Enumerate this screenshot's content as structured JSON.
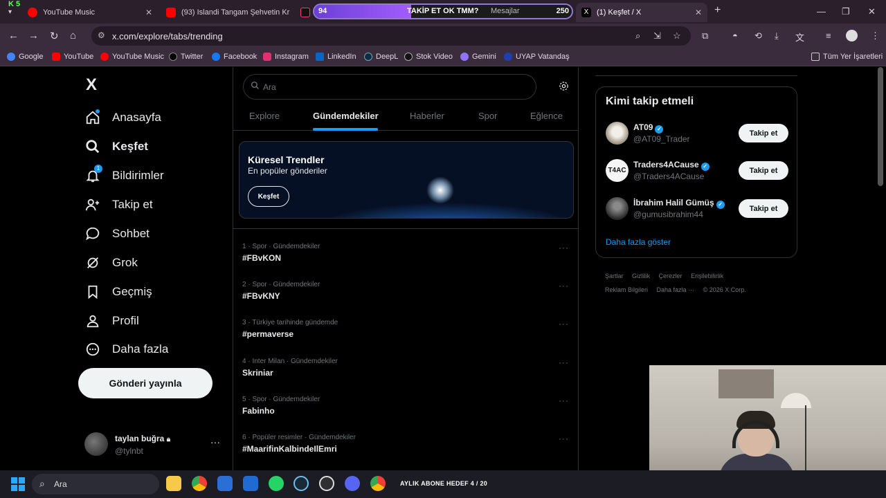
{
  "browser": {
    "tabs": [
      {
        "label": "YouTube Music",
        "color": "#ff0000"
      },
      {
        "label": "(93) Islandi Tangam Şehvetin Kr",
        "color": "#ff0000"
      },
      {
        "label": "Mesajlar",
        "color": "#111111"
      },
      {
        "label": "(1) Keşfet / X",
        "color": "#000000"
      }
    ],
    "overlay": {
      "left": "94",
      "center": "TAKİP ET OK TMM?",
      "right": "250",
      "progress": 0.376
    },
    "badge": "K 5",
    "url": "x.com/explore/tabs/trending",
    "bookmarks": [
      {
        "label": "Google",
        "color": "#4285f4"
      },
      {
        "label": "YouTube",
        "color": "#ff0000"
      },
      {
        "label": "YouTube Music",
        "color": "#ff0000"
      },
      {
        "label": "Twitter",
        "color": "#000000"
      },
      {
        "label": "Facebook",
        "color": "#1877f2"
      },
      {
        "label": "Instagram",
        "color": "#e1306c"
      },
      {
        "label": "LinkedIn",
        "color": "#0a66c2"
      },
      {
        "label": "DeepL",
        "color": "#0f2b46"
      },
      {
        "label": "Stok Video",
        "color": "#111111"
      },
      {
        "label": "Gemini",
        "color": "#8e75ff"
      },
      {
        "label": "UYAP Vatandaş",
        "color": "#1e40af"
      }
    ],
    "bookmarks_all": "Tüm Yer İşaretleri"
  },
  "nav": {
    "logo": "X",
    "items": [
      {
        "label": "Anasayfa",
        "icon": "home-icon"
      },
      {
        "label": "Keşfet",
        "icon": "search-icon"
      },
      {
        "label": "Bildirimler",
        "icon": "bell-icon",
        "badge": "1"
      },
      {
        "label": "Takip et",
        "icon": "person-add-icon"
      },
      {
        "label": "Sohbet",
        "icon": "chat-icon"
      },
      {
        "label": "Grok",
        "icon": "grok-icon"
      },
      {
        "label": "Geçmiş",
        "icon": "bookmark-icon"
      },
      {
        "label": "Profil",
        "icon": "person-icon"
      },
      {
        "label": "Daha fazla",
        "icon": "more-circle-icon"
      }
    ],
    "post_button": "Gönderi yayınla",
    "profile": {
      "name": "taylan buğra",
      "handle": "@tylnbt"
    }
  },
  "explore": {
    "search_placeholder": "Ara",
    "tabs": [
      "Explore",
      "Gündemdekiler",
      "Haberler",
      "Spor",
      "Eğlence"
    ],
    "active_tab": "Gündemdekiler",
    "banner": {
      "title": "Küresel Trendler",
      "subtitle": "En popüler gönderiler",
      "button": "Keşfet"
    },
    "trends": [
      {
        "meta": "1 · Spor · Gündemdekiler",
        "name": "#FBvKON"
      },
      {
        "meta": "2 · Spor · Gündemdekiler",
        "name": "#FBvKNY"
      },
      {
        "meta": "3 · Türkiye tarihinde gündemde",
        "name": "#permaverse"
      },
      {
        "meta": "4 · Inter Milan · Gündemdekiler",
        "name": "Skriniar"
      },
      {
        "meta": "5 · Spor · Gündemdekiler",
        "name": "Fabinho"
      },
      {
        "meta": "6 · Popüler resimler · Gündemdekiler",
        "name": "#MaarifinKalbindeIlEmri"
      }
    ]
  },
  "who_to_follow": {
    "title": "Kimi takip etmeli",
    "accounts": [
      {
        "name": "AT09",
        "handle": "@AT09_Trader",
        "button": "Takip et"
      },
      {
        "name": "Traders4ACause",
        "handle": "@Traders4ACause",
        "button": "Takip et"
      },
      {
        "name": "İbrahim Halil Gümüş",
        "handle": "@gumusibrahim44",
        "button": "Takip et"
      }
    ],
    "show_more": "Daha fazla göster"
  },
  "footer": [
    "Şartlar",
    "Gizlilik",
    "Çerezler",
    "Erişilebilirlik",
    "Reklam Bilgileri",
    "Daha fazla ···",
    "© 2026 X Corp."
  ],
  "taskbar": {
    "search_placeholder": "Ara",
    "goal": "AYLIK ABONE HEDEF 4 / 20"
  },
  "colors": {
    "accent": "#1d9bf0",
    "background": "#000000",
    "browser_frame": "#3a2c3c"
  }
}
